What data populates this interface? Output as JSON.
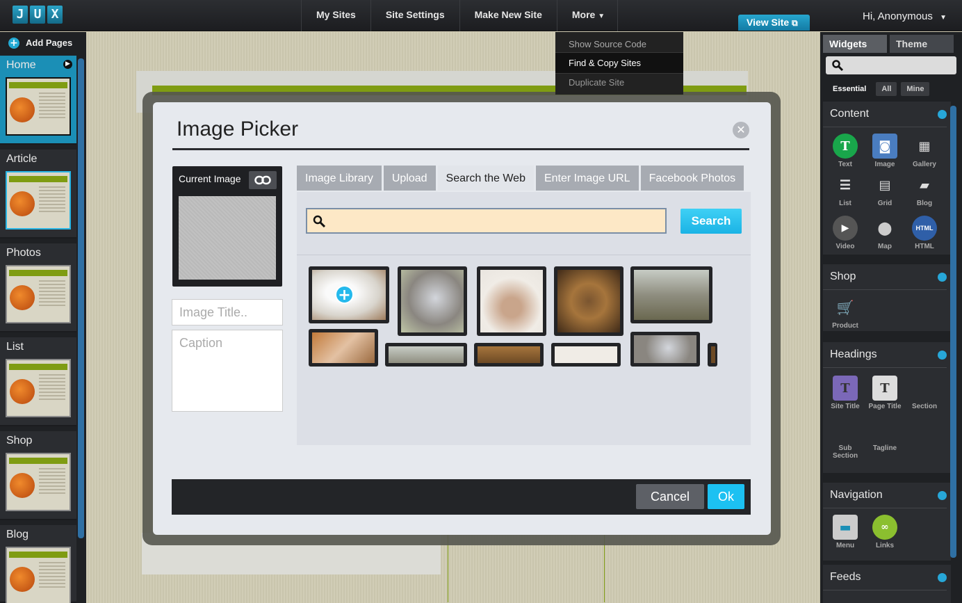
{
  "topbar": {
    "logo_letters": [
      "J",
      "U",
      "X"
    ],
    "nav": [
      "My Sites",
      "Site Settings",
      "Make New Site",
      "More"
    ],
    "view_site": "View Site",
    "greeting": "Hi, Anonymous"
  },
  "more_menu": [
    "Show Source Code",
    "Find & Copy Sites",
    "Duplicate Site"
  ],
  "left": {
    "add_pages": "Add Pages",
    "pages": [
      "Home",
      "Article",
      "Photos",
      "List",
      "Shop",
      "Blog"
    ]
  },
  "right": {
    "tabs": [
      "Widgets",
      "Theme"
    ],
    "filters": [
      "Essential",
      "All",
      "Mine"
    ],
    "sections": {
      "content": {
        "title": "Content",
        "widgets": [
          "Text",
          "Image",
          "Gallery",
          "List",
          "Grid",
          "Blog",
          "Video",
          "Map",
          "HTML"
        ]
      },
      "shop": {
        "title": "Shop",
        "widgets": [
          "Product"
        ]
      },
      "headings": {
        "title": "Headings",
        "widgets": [
          "Site Title",
          "Page Title",
          "Section",
          "Sub Section",
          "Tagline"
        ]
      },
      "navigation": {
        "title": "Navigation",
        "widgets": [
          "Menu",
          "Links"
        ]
      },
      "feeds": {
        "title": "Feeds"
      }
    }
  },
  "modal": {
    "title": "Image Picker",
    "current_image": "Current Image",
    "title_placeholder": "Image Title..",
    "caption_placeholder": "Caption",
    "tabs": [
      "Image Library",
      "Upload",
      "Search the Web",
      "Enter Image URL",
      "Facebook Photos"
    ],
    "active_tab": "Search the Web",
    "search_button": "Search",
    "cancel": "Cancel",
    "ok": "Ok"
  },
  "colors": {
    "accent": "#1cc1f2",
    "topbar": "#1f2124",
    "search_field": "#fde8c6"
  }
}
